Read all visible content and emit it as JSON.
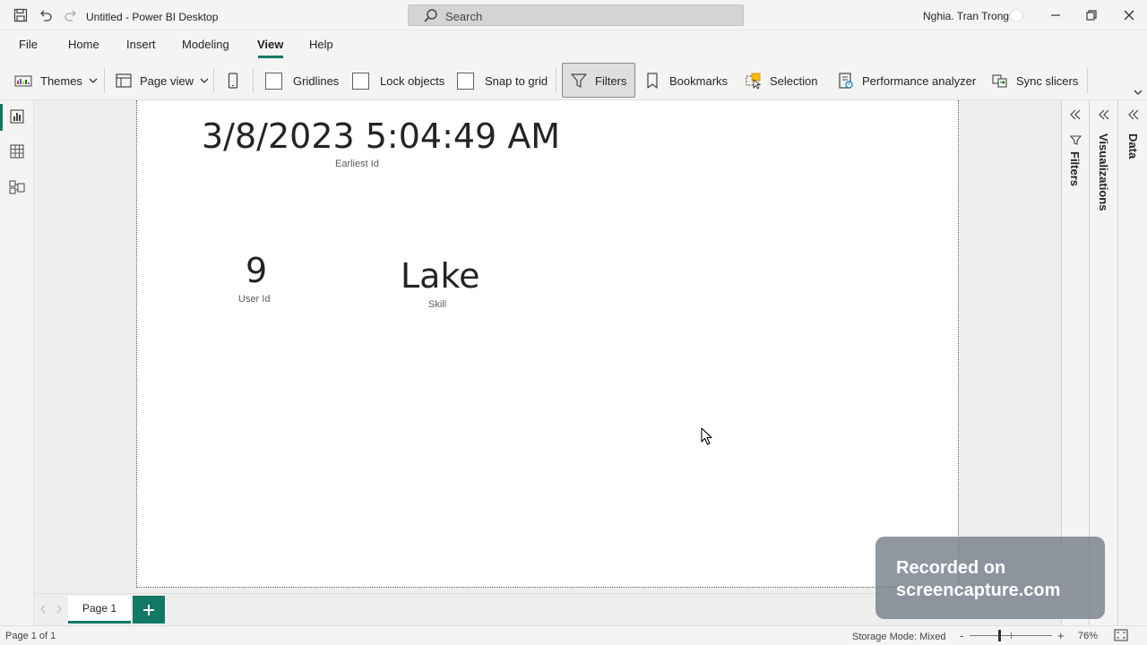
{
  "titlebar": {
    "title": "Untitled - Power BI Desktop",
    "search_placeholder": "Search",
    "user_name": "Nghia. Tran Trong"
  },
  "menu": {
    "items": [
      "File",
      "Home",
      "Insert",
      "Modeling",
      "View",
      "Help"
    ],
    "active": "View"
  },
  "ribbon": {
    "themes": "Themes",
    "page_view": "Page view",
    "gridlines": "Gridlines",
    "lock_objects": "Lock objects",
    "snap_to_grid": "Snap to grid",
    "filters": "Filters",
    "bookmarks": "Bookmarks",
    "selection": "Selection",
    "performance_analyzer": "Performance analyzer",
    "sync_slicers": "Sync slicers"
  },
  "cards": {
    "earliest": {
      "value": "3/8/2023 5:04:49 AM",
      "label": "Earliest Id"
    },
    "user": {
      "value": "9",
      "label": "User Id"
    },
    "skill": {
      "value": "Lake",
      "label": "Skill"
    }
  },
  "panes": {
    "filters": "Filters",
    "visualizations": "Visualizations",
    "data": "Data"
  },
  "pages": {
    "tab": "Page 1"
  },
  "status": {
    "page": "Page 1 of 1",
    "storage_mode": "Storage Mode: Mixed",
    "zoom": "76%",
    "zoom_minus": "-",
    "zoom_plus": "+"
  },
  "watermark": {
    "line1": "Recorded on",
    "line2": "screencapture.com"
  },
  "colors": {
    "accent": "#117865",
    "canvas": "#ffffff",
    "chrome": "#f4f4f2"
  }
}
